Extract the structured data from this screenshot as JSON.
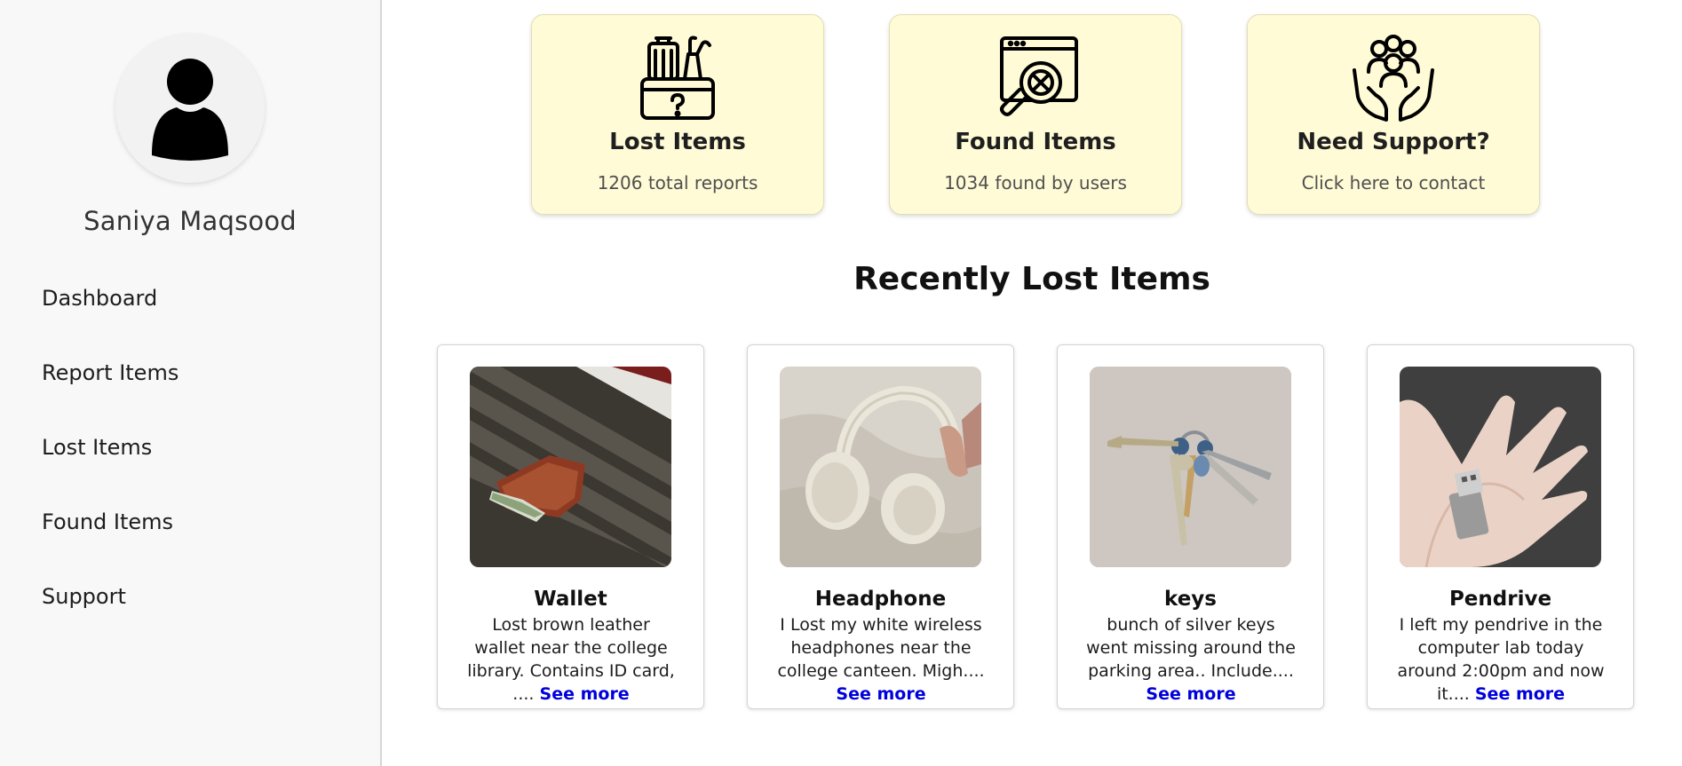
{
  "sidebar": {
    "username": "Saniya Maqsood",
    "nav": [
      "Dashboard",
      "Report Items",
      "Lost Items",
      "Found Items",
      "Support"
    ]
  },
  "stats": [
    {
      "icon": "luggage-question-icon",
      "title": "Lost Items",
      "sub": "1206 total reports"
    },
    {
      "icon": "search-x-icon",
      "title": "Found Items",
      "sub": "1034 found by users"
    },
    {
      "icon": "hands-people-icon",
      "title": "Need Support?",
      "sub": "Click here to contact"
    }
  ],
  "recent": {
    "title": "Recently Lost Items",
    "see_more_label": "See more",
    "items": [
      {
        "name": "Wallet",
        "desc": "Lost brown leather wallet near the college library. Contains ID card, ....",
        "image": "wallet-photo"
      },
      {
        "name": "Headphone",
        "desc": "I Lost my white wireless headphones near the college canteen. Migh....",
        "image": "headphones-photo"
      },
      {
        "name": "keys",
        "desc": "bunch of silver keys went missing around the parking area.. Include....",
        "image": "keys-photo"
      },
      {
        "name": "Pendrive",
        "desc": "I left my pendrive in the computer lab today around 2:00pm and now it....",
        "image": "pendrive-photo"
      }
    ]
  },
  "colors": {
    "sidebar_bg": "#f8f8f8",
    "stat_card_bg": "#fffbd6",
    "link": "#0000dd"
  }
}
